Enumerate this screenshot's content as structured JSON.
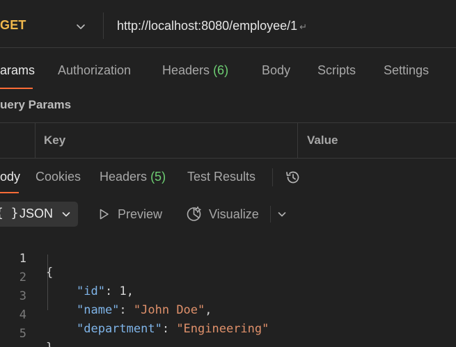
{
  "request": {
    "method": "GET",
    "url": "http://localhost:8080/employee/1",
    "return_glyph": "↵"
  },
  "request_tabs": [
    {
      "label": "arams"
    },
    {
      "label": "Authorization"
    },
    {
      "label": "Headers",
      "count": "(6)"
    },
    {
      "label": "Body"
    },
    {
      "label": "Scripts"
    },
    {
      "label": "Settings"
    }
  ],
  "query_params": {
    "title": "uery Params",
    "columns": [
      "Key",
      "Value"
    ]
  },
  "response_tabs": [
    {
      "label": "ody"
    },
    {
      "label": "Cookies"
    },
    {
      "label": "Headers",
      "count": "(5)"
    },
    {
      "label": "Test Results"
    }
  ],
  "toolbar": {
    "format_braces": "{ }",
    "format_label": "JSON",
    "preview_label": "Preview",
    "visualize_label": "Visualize"
  },
  "code": {
    "line_numbers": [
      "1",
      "2",
      "3",
      "4",
      "5"
    ],
    "open_brace": "{",
    "close_brace": "}",
    "fields": [
      {
        "key": "\"id\"",
        "colon": ": ",
        "value": "1",
        "tail": ","
      },
      {
        "key": "\"name\"",
        "colon": ": ",
        "value": "\"John Doe\"",
        "tail": ","
      },
      {
        "key": "\"department\"",
        "colon": ": ",
        "value": "\"Engineering\"",
        "tail": ""
      }
    ]
  },
  "colors": {
    "method": "#f0b84c",
    "accent": "#ff6c37",
    "count": "#6ecf73",
    "json_key": "#7fb4e8",
    "json_string": "#e0916b"
  },
  "icons": [
    "chevron-down-icon",
    "history-icon",
    "play-icon",
    "visualize-icon"
  ]
}
